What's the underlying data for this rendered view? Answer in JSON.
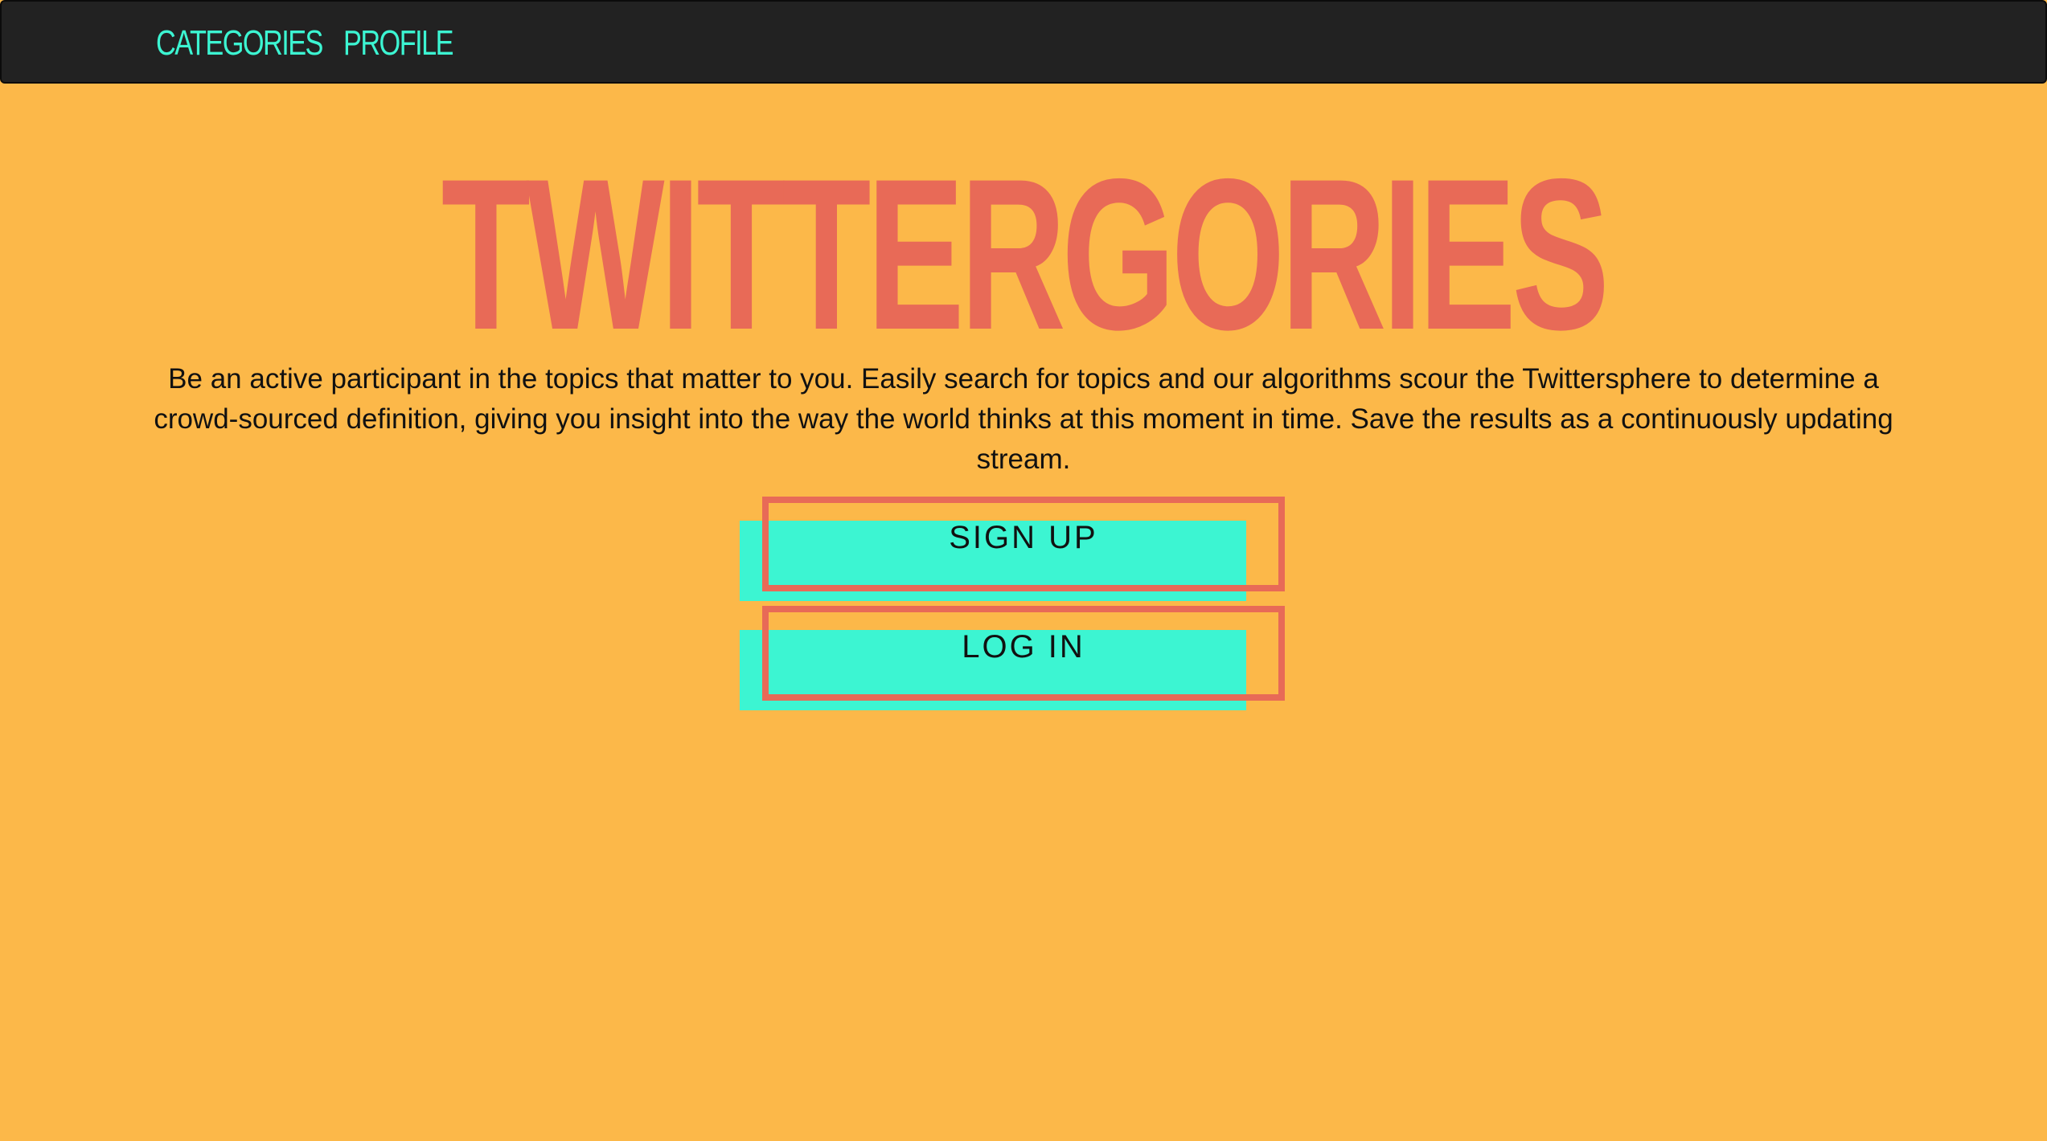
{
  "nav": {
    "categories_label": "CATEGORIES",
    "profile_label": "PROFILE"
  },
  "hero": {
    "title": "TWITTERGORIES",
    "description": "Be an active participant in the topics that matter to you. Easily search for topics and our algorithms scour the Twittersphere to determine a crowd-sourced definition, giving you insight into the way the world thinks at this moment in time. Save the results as a continuously updating stream."
  },
  "actions": {
    "signup_label": "SIGN UP",
    "login_label": "LOG IN"
  },
  "colors": {
    "background": "#fcb849",
    "navbar": "#222222",
    "accent_teal": "#3cf5d2",
    "accent_coral": "#e86a57"
  }
}
